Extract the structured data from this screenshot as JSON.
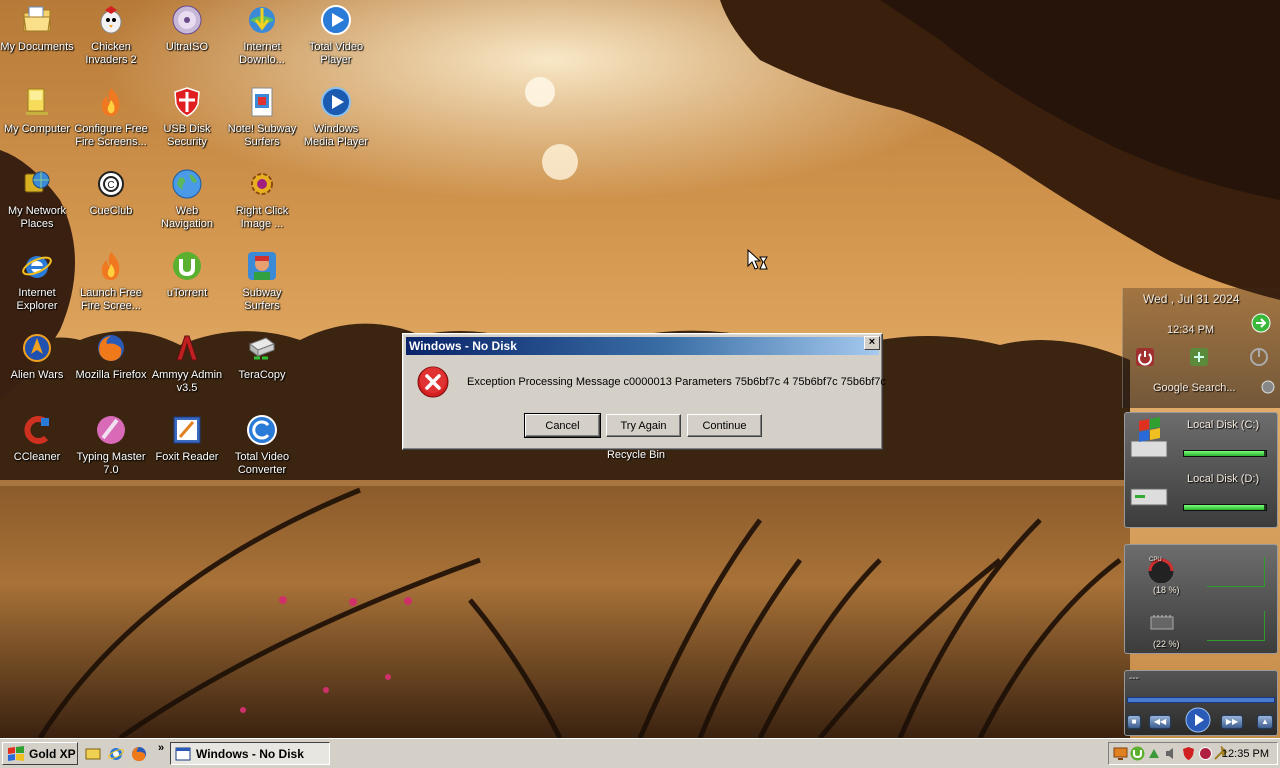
{
  "desktop": {
    "icons": [
      {
        "label": "My Documents",
        "icon": "folder-documents-icon"
      },
      {
        "label": "Chicken Invaders 2",
        "icon": "chicken-invaders-icon"
      },
      {
        "label": "UltraISO",
        "icon": "disc-icon"
      },
      {
        "label": "Internet Downlo...",
        "icon": "internet-download-manager-icon"
      },
      {
        "label": "Total Video Player",
        "icon": "video-player-icon"
      },
      {
        "label": "My Computer",
        "icon": "computer-icon"
      },
      {
        "label": "Configure Free Fire Screens...",
        "icon": "flame-icon"
      },
      {
        "label": "USB Disk Security",
        "icon": "shield-icon"
      },
      {
        "label": "Note! Subway Surfers",
        "icon": "note-icon"
      },
      {
        "label": "Windows Media Player",
        "icon": "media-player-icon"
      },
      {
        "label": "My Network Places",
        "icon": "network-places-icon"
      },
      {
        "label": "CueClub",
        "icon": "cueclub-icon"
      },
      {
        "label": "Web Navigation",
        "icon": "globe-icon"
      },
      {
        "label": "Right Click Image ...",
        "icon": "gear-icon"
      },
      {
        "label": "Internet Explorer",
        "icon": "internet-explorer-icon"
      },
      {
        "label": "Launch Free Fire Scree...",
        "icon": "flame-icon"
      },
      {
        "label": "uTorrent",
        "icon": "utorrent-icon"
      },
      {
        "label": "Subway Surfers",
        "icon": "subway-surfers-icon"
      },
      {
        "label": "Alien Wars",
        "icon": "alien-wars-icon"
      },
      {
        "label": "Mozilla Firefox",
        "icon": "firefox-icon"
      },
      {
        "label": "Ammyy Admin v3.5",
        "icon": "ammyy-admin-icon"
      },
      {
        "label": "TeraCopy",
        "icon": "teracopy-icon"
      },
      {
        "label": "CCleaner",
        "icon": "ccleaner-icon"
      },
      {
        "label": "Typing Master 7.0",
        "icon": "typing-master-icon"
      },
      {
        "label": "Foxit Reader",
        "icon": "foxit-reader-icon"
      },
      {
        "label": "Total Video Converter",
        "icon": "video-converter-icon"
      }
    ],
    "recycle_bin_label": "Recycle Bin"
  },
  "dialog": {
    "title": "Windows - No Disk",
    "close_glyph": "×",
    "message": "Exception Processing Message c0000013 Parameters 75b6bf7c 4 75b6bf7c 75b6bf7c",
    "buttons": {
      "cancel": "Cancel",
      "try_again": "Try Again",
      "continue": "Continue"
    }
  },
  "sidebar": {
    "date": "Wed , Jul 31 2024",
    "time": "12:34 PM",
    "search_placeholder": "Google Search...",
    "drives": [
      {
        "label": "Local Disk (C:)",
        "fill_fraction": 0.97
      },
      {
        "label": "Local Disk (D:)",
        "fill_fraction": 0.97
      }
    ],
    "cpu": {
      "label": "CPU",
      "usage": "(18 %)"
    },
    "ram": {
      "usage": "(22 %)"
    },
    "media": {
      "track": "---"
    }
  },
  "taskbar": {
    "start_label": "Gold XP",
    "chevron": "»",
    "task_title": "Windows - No Disk",
    "clock": "12:35 PM"
  },
  "colors": {
    "title_bar_start": "#0a246a",
    "title_bar_end": "#a6caf0",
    "dialog_face": "#d4d0c8",
    "error_red": "#d42020",
    "bar_green": "#3dd13d"
  }
}
